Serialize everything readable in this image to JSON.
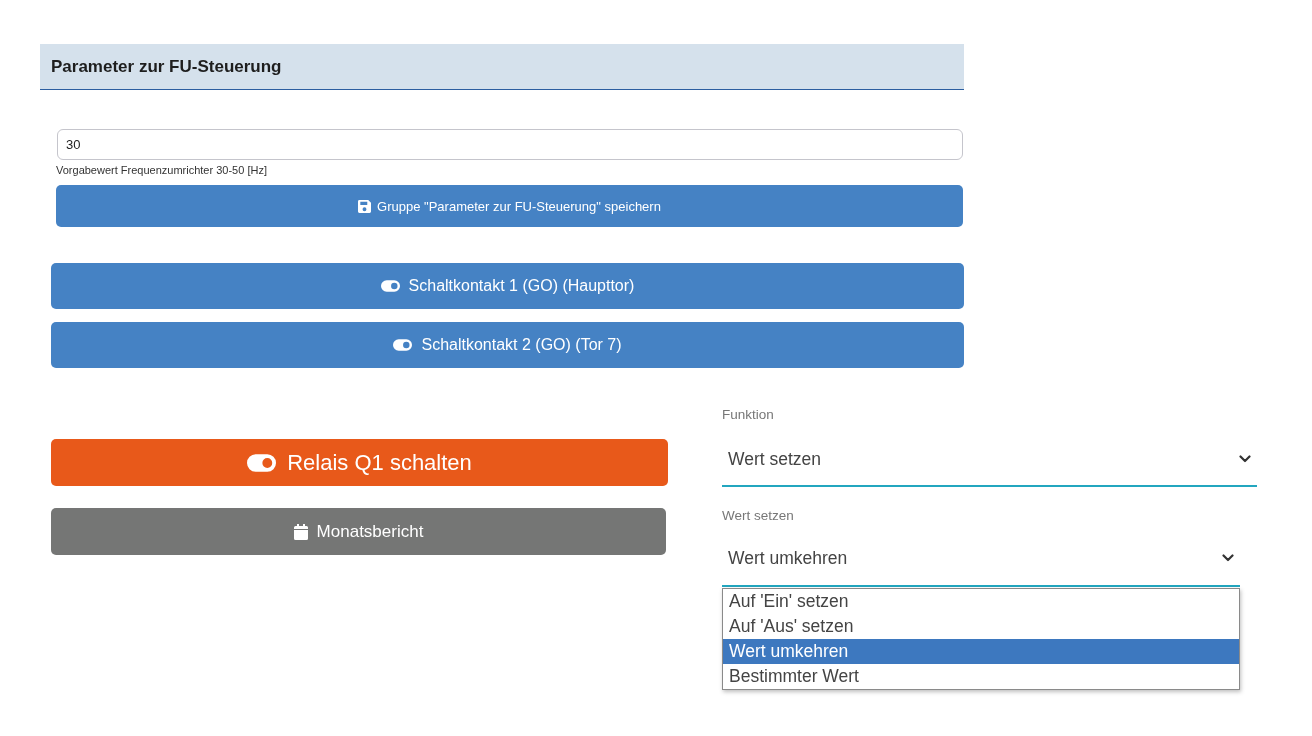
{
  "panel": {
    "title": "Parameter zur FU-Steuerung",
    "field": {
      "value": "30",
      "help": "Vorgabewert Frequenzumrichter 30-50 [Hz]"
    },
    "save_button": {
      "label": "Gruppe \"Parameter zur FU-Steuerung\" speichern"
    }
  },
  "contact_buttons": [
    {
      "label": "Schaltkontakt 1 (GO) (Haupttor)"
    },
    {
      "label": "Schaltkontakt 2 (GO) (Tor 7)"
    }
  ],
  "relay_button": {
    "label": "Relais Q1 schalten"
  },
  "report_button": {
    "label": "Monatsbericht"
  },
  "function_select": {
    "label": "Funktion",
    "value": "Wert setzen"
  },
  "value_select": {
    "label": "Wert setzen",
    "value": "Wert umkehren",
    "expanded": true,
    "options": [
      {
        "label": "Auf 'Ein' setzen",
        "selected": false
      },
      {
        "label": "Auf 'Aus' setzen",
        "selected": false
      },
      {
        "label": "Wert umkehren",
        "selected": true
      },
      {
        "label": "Bestimmter Wert",
        "selected": false
      }
    ]
  }
}
